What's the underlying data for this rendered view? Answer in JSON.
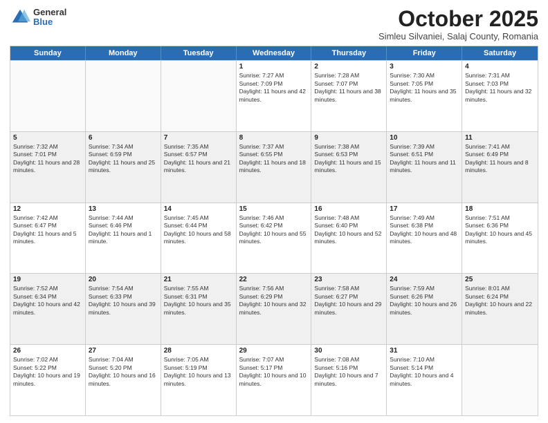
{
  "logo": {
    "general": "General",
    "blue": "Blue"
  },
  "header": {
    "month": "October 2025",
    "location": "Simleu Silvaniei, Salaj County, Romania"
  },
  "days_of_week": [
    "Sunday",
    "Monday",
    "Tuesday",
    "Wednesday",
    "Thursday",
    "Friday",
    "Saturday"
  ],
  "weeks": [
    [
      {
        "day": "",
        "empty": true
      },
      {
        "day": "",
        "empty": true
      },
      {
        "day": "",
        "empty": true
      },
      {
        "day": "1",
        "sunrise": "Sunrise: 7:27 AM",
        "sunset": "Sunset: 7:09 PM",
        "daylight": "Daylight: 11 hours and 42 minutes."
      },
      {
        "day": "2",
        "sunrise": "Sunrise: 7:28 AM",
        "sunset": "Sunset: 7:07 PM",
        "daylight": "Daylight: 11 hours and 38 minutes."
      },
      {
        "day": "3",
        "sunrise": "Sunrise: 7:30 AM",
        "sunset": "Sunset: 7:05 PM",
        "daylight": "Daylight: 11 hours and 35 minutes."
      },
      {
        "day": "4",
        "sunrise": "Sunrise: 7:31 AM",
        "sunset": "Sunset: 7:03 PM",
        "daylight": "Daylight: 11 hours and 32 minutes."
      }
    ],
    [
      {
        "day": "5",
        "sunrise": "Sunrise: 7:32 AM",
        "sunset": "Sunset: 7:01 PM",
        "daylight": "Daylight: 11 hours and 28 minutes."
      },
      {
        "day": "6",
        "sunrise": "Sunrise: 7:34 AM",
        "sunset": "Sunset: 6:59 PM",
        "daylight": "Daylight: 11 hours and 25 minutes."
      },
      {
        "day": "7",
        "sunrise": "Sunrise: 7:35 AM",
        "sunset": "Sunset: 6:57 PM",
        "daylight": "Daylight: 11 hours and 21 minutes."
      },
      {
        "day": "8",
        "sunrise": "Sunrise: 7:37 AM",
        "sunset": "Sunset: 6:55 PM",
        "daylight": "Daylight: 11 hours and 18 minutes."
      },
      {
        "day": "9",
        "sunrise": "Sunrise: 7:38 AM",
        "sunset": "Sunset: 6:53 PM",
        "daylight": "Daylight: 11 hours and 15 minutes."
      },
      {
        "day": "10",
        "sunrise": "Sunrise: 7:39 AM",
        "sunset": "Sunset: 6:51 PM",
        "daylight": "Daylight: 11 hours and 11 minutes."
      },
      {
        "day": "11",
        "sunrise": "Sunrise: 7:41 AM",
        "sunset": "Sunset: 6:49 PM",
        "daylight": "Daylight: 11 hours and 8 minutes."
      }
    ],
    [
      {
        "day": "12",
        "sunrise": "Sunrise: 7:42 AM",
        "sunset": "Sunset: 6:47 PM",
        "daylight": "Daylight: 11 hours and 5 minutes."
      },
      {
        "day": "13",
        "sunrise": "Sunrise: 7:44 AM",
        "sunset": "Sunset: 6:46 PM",
        "daylight": "Daylight: 11 hours and 1 minute."
      },
      {
        "day": "14",
        "sunrise": "Sunrise: 7:45 AM",
        "sunset": "Sunset: 6:44 PM",
        "daylight": "Daylight: 10 hours and 58 minutes."
      },
      {
        "day": "15",
        "sunrise": "Sunrise: 7:46 AM",
        "sunset": "Sunset: 6:42 PM",
        "daylight": "Daylight: 10 hours and 55 minutes."
      },
      {
        "day": "16",
        "sunrise": "Sunrise: 7:48 AM",
        "sunset": "Sunset: 6:40 PM",
        "daylight": "Daylight: 10 hours and 52 minutes."
      },
      {
        "day": "17",
        "sunrise": "Sunrise: 7:49 AM",
        "sunset": "Sunset: 6:38 PM",
        "daylight": "Daylight: 10 hours and 48 minutes."
      },
      {
        "day": "18",
        "sunrise": "Sunrise: 7:51 AM",
        "sunset": "Sunset: 6:36 PM",
        "daylight": "Daylight: 10 hours and 45 minutes."
      }
    ],
    [
      {
        "day": "19",
        "sunrise": "Sunrise: 7:52 AM",
        "sunset": "Sunset: 6:34 PM",
        "daylight": "Daylight: 10 hours and 42 minutes."
      },
      {
        "day": "20",
        "sunrise": "Sunrise: 7:54 AM",
        "sunset": "Sunset: 6:33 PM",
        "daylight": "Daylight: 10 hours and 39 minutes."
      },
      {
        "day": "21",
        "sunrise": "Sunrise: 7:55 AM",
        "sunset": "Sunset: 6:31 PM",
        "daylight": "Daylight: 10 hours and 35 minutes."
      },
      {
        "day": "22",
        "sunrise": "Sunrise: 7:56 AM",
        "sunset": "Sunset: 6:29 PM",
        "daylight": "Daylight: 10 hours and 32 minutes."
      },
      {
        "day": "23",
        "sunrise": "Sunrise: 7:58 AM",
        "sunset": "Sunset: 6:27 PM",
        "daylight": "Daylight: 10 hours and 29 minutes."
      },
      {
        "day": "24",
        "sunrise": "Sunrise: 7:59 AM",
        "sunset": "Sunset: 6:26 PM",
        "daylight": "Daylight: 10 hours and 26 minutes."
      },
      {
        "day": "25",
        "sunrise": "Sunrise: 8:01 AM",
        "sunset": "Sunset: 6:24 PM",
        "daylight": "Daylight: 10 hours and 22 minutes."
      }
    ],
    [
      {
        "day": "26",
        "sunrise": "Sunrise: 7:02 AM",
        "sunset": "Sunset: 5:22 PM",
        "daylight": "Daylight: 10 hours and 19 minutes."
      },
      {
        "day": "27",
        "sunrise": "Sunrise: 7:04 AM",
        "sunset": "Sunset: 5:20 PM",
        "daylight": "Daylight: 10 hours and 16 minutes."
      },
      {
        "day": "28",
        "sunrise": "Sunrise: 7:05 AM",
        "sunset": "Sunset: 5:19 PM",
        "daylight": "Daylight: 10 hours and 13 minutes."
      },
      {
        "day": "29",
        "sunrise": "Sunrise: 7:07 AM",
        "sunset": "Sunset: 5:17 PM",
        "daylight": "Daylight: 10 hours and 10 minutes."
      },
      {
        "day": "30",
        "sunrise": "Sunrise: 7:08 AM",
        "sunset": "Sunset: 5:16 PM",
        "daylight": "Daylight: 10 hours and 7 minutes."
      },
      {
        "day": "31",
        "sunrise": "Sunrise: 7:10 AM",
        "sunset": "Sunset: 5:14 PM",
        "daylight": "Daylight: 10 hours and 4 minutes."
      },
      {
        "day": "",
        "empty": true
      }
    ]
  ]
}
